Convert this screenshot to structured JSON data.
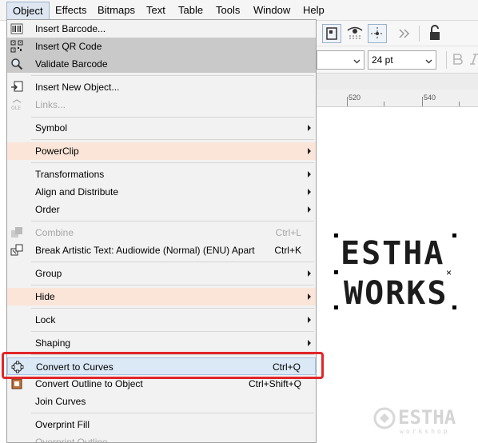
{
  "menubar": {
    "items": [
      {
        "label": "Object",
        "active": true
      },
      {
        "label": "Effects"
      },
      {
        "label": "Bitmaps"
      },
      {
        "label": "Text"
      },
      {
        "label": "Table"
      },
      {
        "label": "Tools"
      },
      {
        "label": "Window"
      },
      {
        "label": "Help"
      }
    ]
  },
  "toolbar": {
    "font_size_value": "24 pt"
  },
  "ruler": {
    "labels": [
      "520",
      "540"
    ]
  },
  "canvas": {
    "line1": "ESTHA",
    "line2": "WORKS"
  },
  "menu": {
    "items": [
      {
        "label": "Insert Barcode...",
        "icon": "barcode-icon"
      },
      {
        "label": "Insert QR Code",
        "icon": "qr-code-icon"
      },
      {
        "label": "Validate Barcode",
        "icon": "magnifier-icon"
      },
      {
        "label": "Insert New Object...",
        "icon": "insert-object-icon"
      },
      {
        "label": "Links...",
        "icon": "ole-icon",
        "disabled": true
      },
      {
        "label": "Symbol",
        "submenu": true
      },
      {
        "label": "PowerClip",
        "submenu": true
      },
      {
        "label": "Transformations",
        "submenu": true
      },
      {
        "label": "Align and Distribute",
        "submenu": true
      },
      {
        "label": "Order",
        "submenu": true
      },
      {
        "label": "Combine",
        "shortcut": "Ctrl+L",
        "disabled": true,
        "icon": "combine-icon"
      },
      {
        "label": "Break Artistic Text: Audiowide (Normal) (ENU) Apart",
        "shortcut": "Ctrl+K",
        "icon": "break-apart-icon"
      },
      {
        "label": "Group",
        "submenu": true
      },
      {
        "label": "Hide",
        "submenu": true
      },
      {
        "label": "Lock",
        "submenu": true
      },
      {
        "label": "Shaping",
        "submenu": true
      },
      {
        "label": "Convert to Curves",
        "shortcut": "Ctrl+Q",
        "icon": "convert-to-curves-icon"
      },
      {
        "label": "Convert Outline to Object",
        "shortcut": "Ctrl+Shift+Q",
        "icon": "outline-to-object-icon"
      },
      {
        "label": "Join Curves"
      },
      {
        "label": "Overprint Fill"
      },
      {
        "label": "Overprint Outline",
        "disabled": true
      }
    ]
  },
  "watermark": {
    "text": "ESTHA",
    "subtext": "workshop"
  }
}
